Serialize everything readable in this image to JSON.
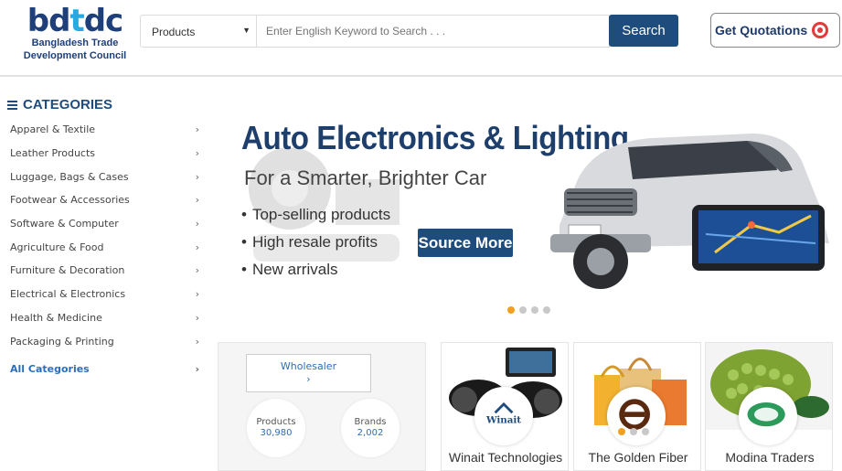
{
  "header": {
    "logo_mark": "bdtdc",
    "logo_line1": "Bangladesh Trade",
    "logo_line2": "Development Council",
    "category_select": "Products",
    "search_placeholder": "Enter English Keyword to Search . . .",
    "search_button": "Search",
    "quotation_button": "Get Quotations"
  },
  "sidebar": {
    "title": "CATEGORIES",
    "items": [
      {
        "label": "Apparel & Textile"
      },
      {
        "label": "Leather Products"
      },
      {
        "label": "Luggage, Bags & Cases"
      },
      {
        "label": "Footwear & Accessories"
      },
      {
        "label": "Software & Computer"
      },
      {
        "label": "Agriculture & Food"
      },
      {
        "label": "Furniture & Decoration"
      },
      {
        "label": "Electrical & Electronics"
      },
      {
        "label": "Health & Medicine"
      },
      {
        "label": "Packaging & Printing"
      }
    ],
    "all_label": "All Categories"
  },
  "banner": {
    "title": "Auto Electronics & Lighting",
    "subtitle": "For a Smarter, Brighter Car",
    "bullets": [
      "Top-selling products",
      "High resale profits",
      "New arrivals"
    ],
    "cta": "Source More",
    "slide_count": 4,
    "active_slide": 1
  },
  "stats": {
    "wholesaler_label": "Wholesaler",
    "wholesaler_chevron": "›",
    "products_label": "Products",
    "products_value": "30,980",
    "brands_label": "Brands",
    "brands_value": "2,002"
  },
  "suppliers": [
    {
      "name": "Winait Technologies",
      "badge_text": "Winait"
    },
    {
      "name": "The Golden Fiber"
    },
    {
      "name": "Modina Traders"
    }
  ],
  "colors": {
    "brand_navy": "#1e4c7c",
    "link_blue": "#2d6eb8",
    "dot_active": "#f0a01e"
  }
}
